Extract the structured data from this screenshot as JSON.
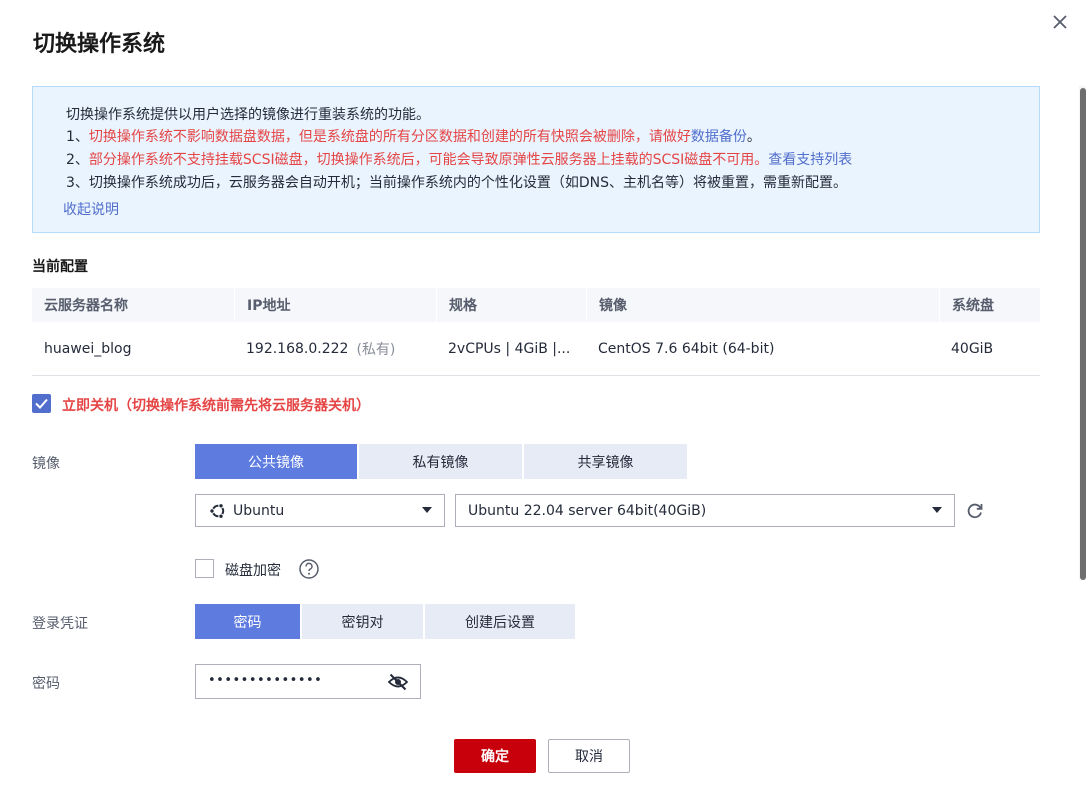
{
  "dialog": {
    "title": "切换操作系统"
  },
  "notice": {
    "intro": "切换操作系统提供以用户选择的镜像进行重装系统的功能。",
    "line1_prefix": "1、",
    "line1_red": "切换操作系统不影响数据盘数据，但是系统盘的所有分区数据和创建的所有快照会被删除，请做好",
    "line1_link": "数据备份",
    "line1_suffix": "。",
    "line2_prefix": "2、",
    "line2_red": "部分操作系统不支持挂载SCSI磁盘，切换操作系统后，可能会导致原弹性云服务器上挂载的SCSI磁盘不可用。",
    "line2_link": "查看支持列表",
    "line3": "3、切换操作系统成功后，云服务器会自动开机；当前操作系统内的个性化设置（如DNS、主机名等）将被重置，需重新配置。",
    "collapse_label": "收起说明"
  },
  "current_config": {
    "title": "当前配置",
    "headers": [
      "云服务器名称",
      "IP地址",
      "规格",
      "镜像",
      "系统盘"
    ],
    "row": {
      "name": "huawei_blog",
      "ip": "192.168.0.222",
      "ip_tag": "(私有)",
      "spec": "2vCPUs | 4GiB |...",
      "image": "CentOS 7.6 64bit (64-bit)",
      "disk": "40GiB"
    }
  },
  "shutdown": {
    "checked": true,
    "label": "立即关机（切换操作系统前需先将云服务器关机）"
  },
  "image": {
    "label": "镜像",
    "tabs": [
      "公共镜像",
      "私有镜像",
      "共享镜像"
    ],
    "active_tab": 0,
    "os_select": "Ubuntu",
    "version_select": "Ubuntu 22.04 server 64bit(40GiB)",
    "os_icon": "ubuntu-logo-icon",
    "refresh_icon": "refresh-icon"
  },
  "encryption": {
    "checked": false,
    "label": "磁盘加密",
    "help_icon": "question-circle-icon"
  },
  "credential": {
    "label": "登录凭证",
    "tabs": [
      "密码",
      "密钥对",
      "创建后设置"
    ],
    "active_tab": 0
  },
  "password": {
    "label": "密码",
    "value": "••••••••••••••",
    "toggle_icon": "eye-slash-icon"
  },
  "actions": {
    "confirm": "确定",
    "cancel": "取消"
  },
  "colors": {
    "accent": "#5e7ce0",
    "danger_text": "#e54545",
    "primary_button": "#c7000b",
    "link": "#526ecc",
    "notice_bg": "#e9f4fe"
  }
}
